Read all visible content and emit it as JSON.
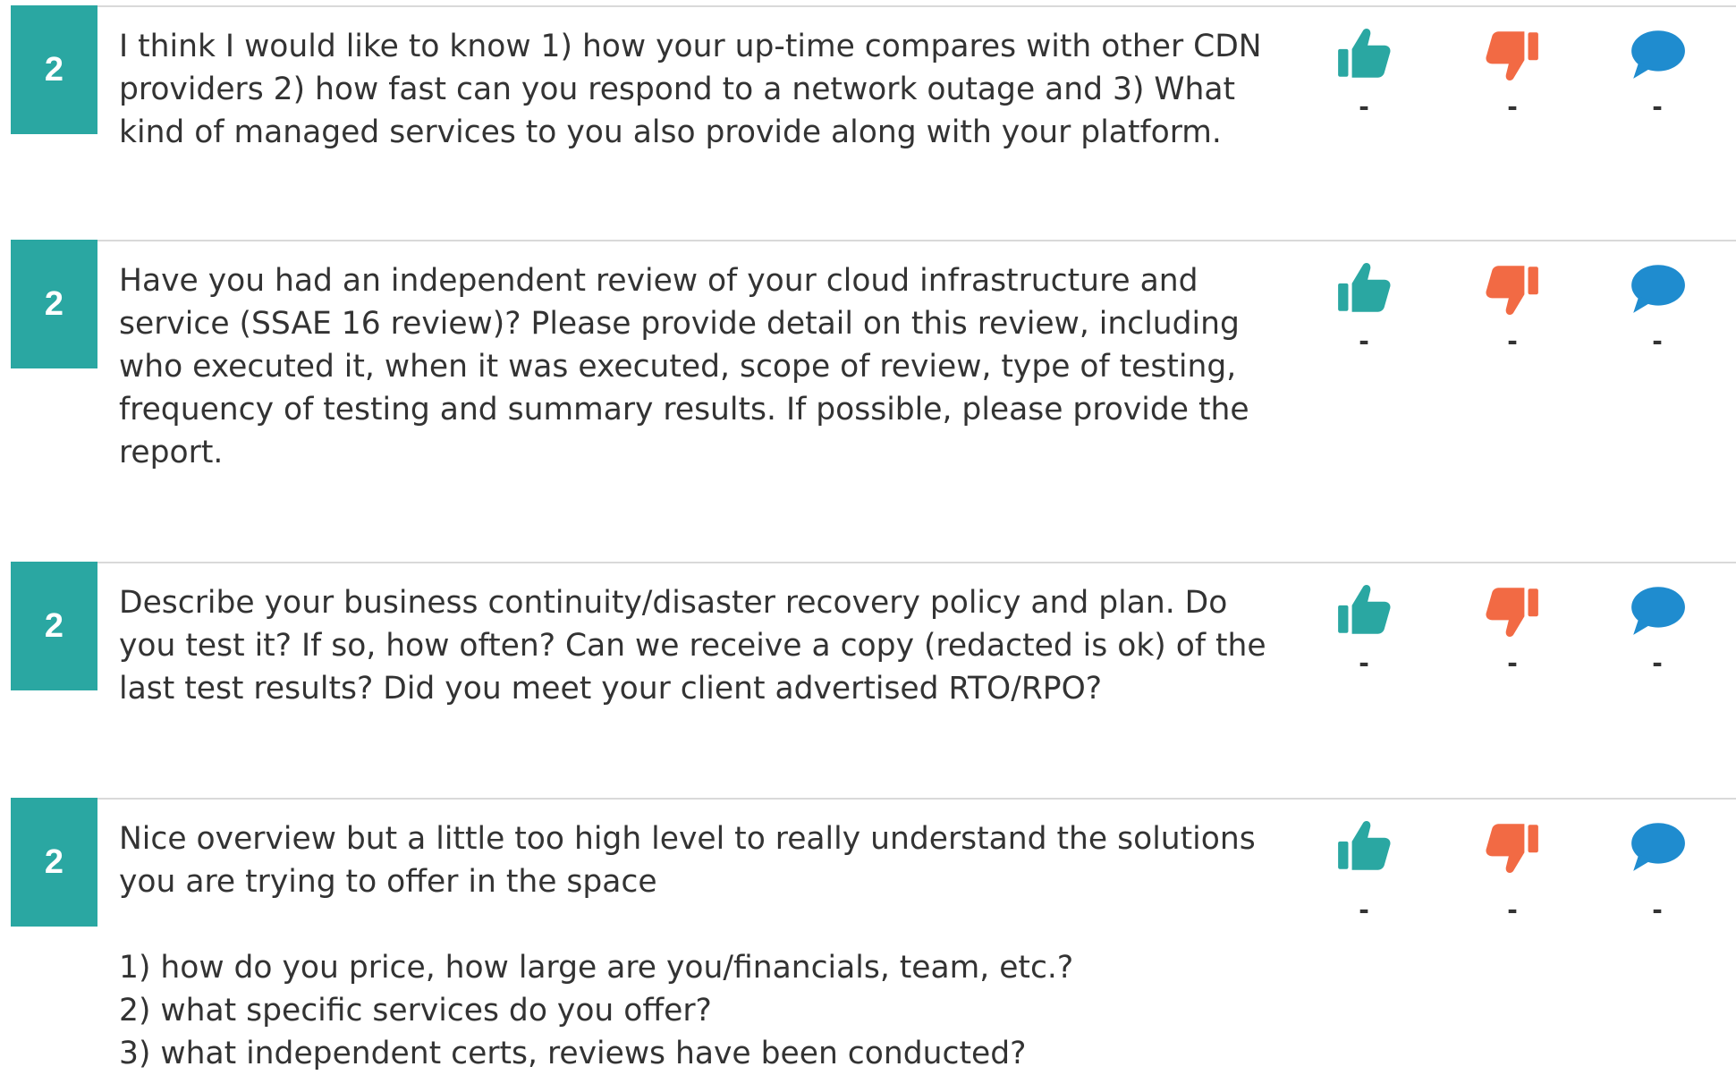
{
  "colors": {
    "badge": "#2aa7a2",
    "like": "#2aa7a2",
    "dislike": "#f26a44",
    "comment": "#1f8ccf",
    "divider": "#d9d9d9",
    "text": "#333333"
  },
  "icons": {
    "like": "thumbs-up-icon",
    "dislike": "thumbs-down-icon",
    "comment": "speech-bubble-icon"
  },
  "items": [
    {
      "score": "2",
      "text": "I think I would like to know 1) how your up-time compares with other CDN providers 2) how fast can you respond to a network outage and 3) What kind of managed services to you also provide along with your platform.",
      "likes": "-",
      "dislikes": "-",
      "comments": "-"
    },
    {
      "score": "2",
      "text": "Have you had an independent review of your cloud infrastructure and service (SSAE 16 review)? Please provide detail on this review, including who executed it, when it was executed, scope of review, type of testing, frequency of testing and summary results. If possible, please provide the report.",
      "likes": "-",
      "dislikes": "-",
      "comments": "-"
    },
    {
      "score": "2",
      "text": "Describe your business continuity/disaster recovery policy and plan. Do you test it? If so, how often? Can we receive a copy (redacted is ok) of the last test results? Did you meet your client advertised RTO/RPO?",
      "likes": "-",
      "dislikes": "-",
      "comments": "-"
    },
    {
      "score": "2",
      "text": "Nice overview but a little too high level to really understand the solutions you are trying to offer in the space\n\n1) how do you price, how large are you/financials, team, etc.?\n2) what specific services do you offer?\n3) what independent certs, reviews have been conducted?",
      "likes": "-",
      "dislikes": "-",
      "comments": "-"
    }
  ]
}
